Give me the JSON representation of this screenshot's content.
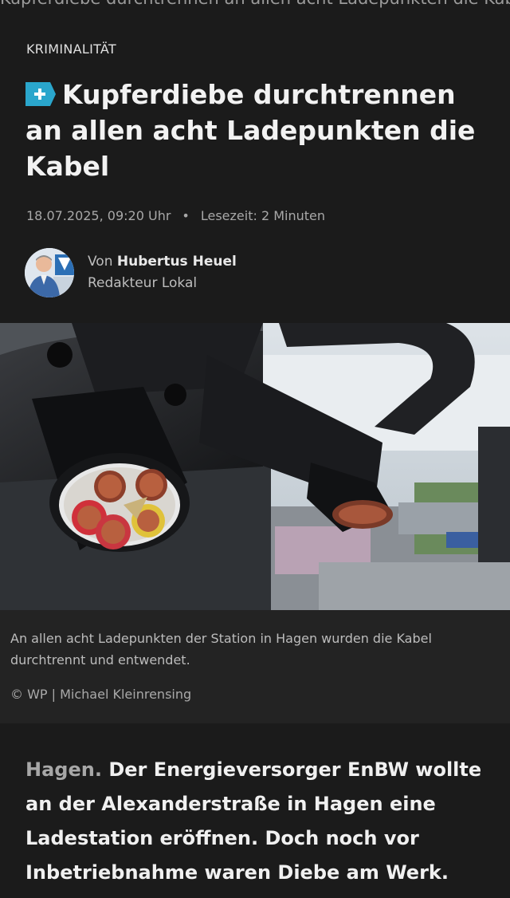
{
  "article": {
    "top_partial_text": "Kupferdiebe durchtrennen an allen acht Ladepunkten die Kabel",
    "category": "KRIMINALITÄT",
    "plus_badge_icon": "plus-badge-icon",
    "headline": "Kupferdiebe durchtrennen an allen acht Ladepunkten die Kabel",
    "date": "18.07.2025, 09:20 Uhr",
    "separator": "•",
    "reading_time": "Lesezeit: 2 Minuten",
    "author": {
      "prefix": "Von",
      "name": "Hubertus Heuel",
      "role": "Redakteur Lokal"
    },
    "image": {
      "caption": "An allen acht Ladepunkten der Station in Hagen wurden die Kabel durchtrennt und entwendet.",
      "credit": "© WP | Michael Kleinrensing"
    },
    "lead": {
      "place": "Hagen.",
      "text": "Der Energieversorger EnBW wollte an der Alexanderstraße in Hagen eine Ladestation eröffnen. Doch noch vor Inbetriebnahme waren Diebe am Werk."
    }
  },
  "colors": {
    "background": "#1b1b1b",
    "caption_background": "#232323",
    "plus_badge": "#2aa6cc"
  }
}
